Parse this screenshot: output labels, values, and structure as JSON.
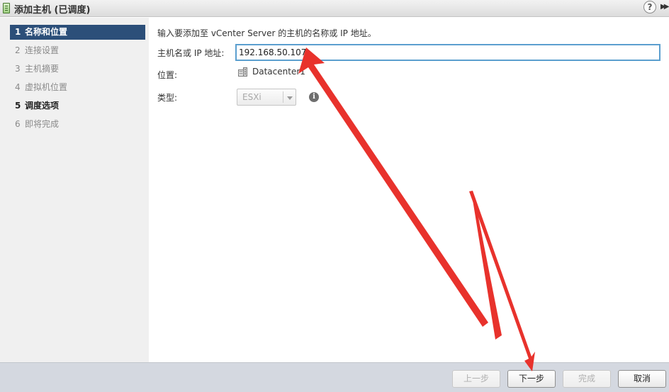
{
  "window": {
    "title": "添加主机 (已调度)",
    "help_symbol": "?",
    "expand_symbol": "▶▶"
  },
  "steps": [
    {
      "num": "1",
      "label": "名称和位置"
    },
    {
      "num": "2",
      "label": "连接设置"
    },
    {
      "num": "3",
      "label": "主机摘要"
    },
    {
      "num": "4",
      "label": "虚拟机位置"
    },
    {
      "num": "5",
      "label": "调度选项"
    },
    {
      "num": "6",
      "label": "即将完成"
    }
  ],
  "form": {
    "instruction": "输入要添加至 vCenter Server 的主机的名称或 IP 地址。",
    "host_label": "主机名或 IP 地址:",
    "host_value": "192.168.50.107",
    "location_label": "位置:",
    "location_value": "Datacenter1",
    "type_label": "类型:",
    "type_value": "ESXi",
    "info_symbol": "i"
  },
  "footer": {
    "back": "上一步",
    "next": "下一步",
    "finish": "完成",
    "cancel": "取消"
  },
  "colors": {
    "active_step": "#2c4f79",
    "input_border": "#5b9fcf",
    "annotation_arrow": "#e8322c"
  },
  "icons": {
    "title": "add-host-icon",
    "location": "datacenter-icon",
    "info": "info-icon"
  }
}
